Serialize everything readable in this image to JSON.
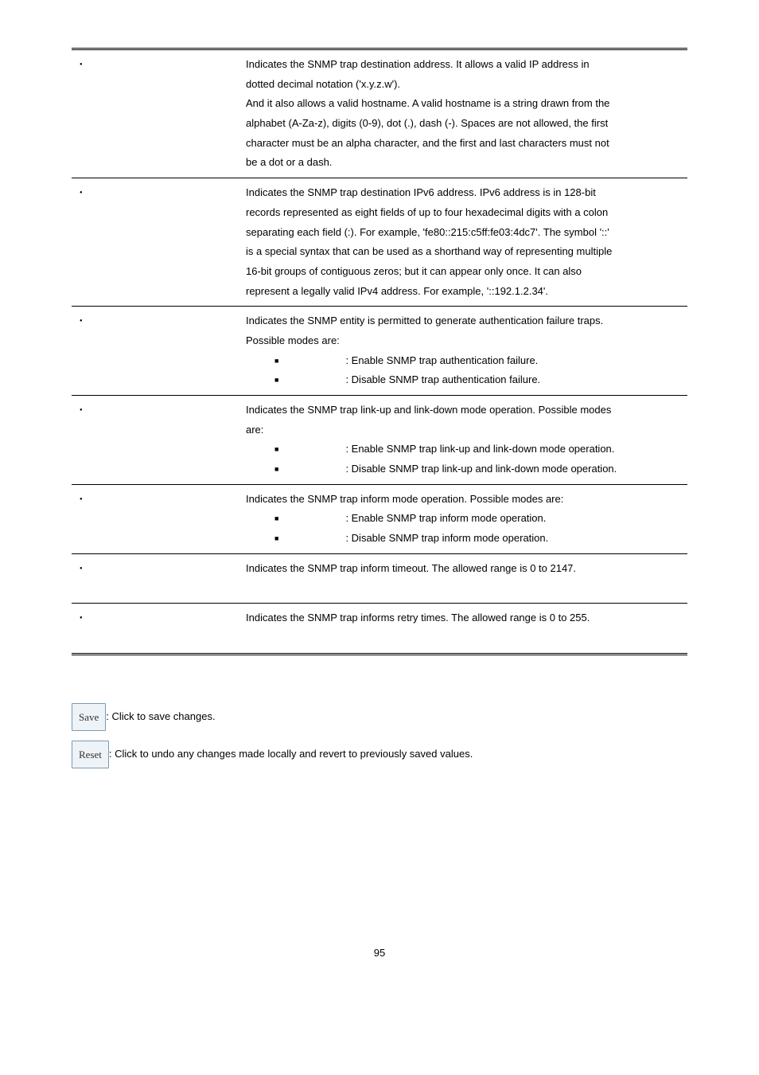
{
  "table": {
    "rows": [
      {
        "desc": [
          "Indicates the SNMP trap destination address. It allows a valid IP address in",
          "dotted decimal notation ('x.y.z.w').",
          "And it also allows a valid hostname. A valid hostname is a string drawn from the",
          "alphabet (A-Za-z), digits (0-9), dot (.), dash (-). Spaces are not allowed, the first",
          "character must be an alpha character, and the first and last characters must not",
          "be a dot or a dash."
        ]
      },
      {
        "desc": [
          "Indicates the SNMP trap destination IPv6 address. IPv6 address is in 128-bit",
          "records represented as eight fields of up to four hexadecimal digits with a colon",
          "separating each field (:). For example, 'fe80::215:c5ff:fe03:4dc7'. The symbol '::'",
          "is a special syntax that can be used as a shorthand way of representing multiple",
          "16-bit groups of contiguous zeros; but it can appear only once. It can also",
          "represent a legally valid IPv4 address. For example, '::192.1.2.34'."
        ]
      },
      {
        "intro": [
          "Indicates the SNMP entity is permitted to generate authentication failure traps.",
          "Possible modes are:"
        ],
        "sub": [
          ": Enable SNMP trap authentication failure.",
          ": Disable SNMP trap authentication failure."
        ]
      },
      {
        "intro": [
          "Indicates the SNMP trap link-up and link-down mode operation. Possible modes",
          "are:"
        ],
        "sub": [
          ": Enable SNMP trap link-up and link-down mode operation.",
          ": Disable SNMP trap link-up and link-down mode operation."
        ]
      },
      {
        "intro": [
          "Indicates the SNMP trap inform mode operation. Possible modes are:"
        ],
        "sub": [
          ": Enable SNMP trap inform mode operation.",
          ": Disable SNMP trap inform mode operation."
        ]
      },
      {
        "desc": [
          "Indicates the SNMP trap inform timeout. The allowed range is 0 to 2147."
        ],
        "pad_bottom": true
      },
      {
        "desc": [
          "Indicates the SNMP trap informs retry times. The allowed range is 0 to 255."
        ],
        "pad_bottom": true
      }
    ]
  },
  "buttons": {
    "save": {
      "label": "Save",
      "text": ": Click to save changes."
    },
    "reset": {
      "label": "Reset",
      "text": ": Click to undo any changes made locally and revert to previously saved values."
    }
  },
  "page_number": "95"
}
